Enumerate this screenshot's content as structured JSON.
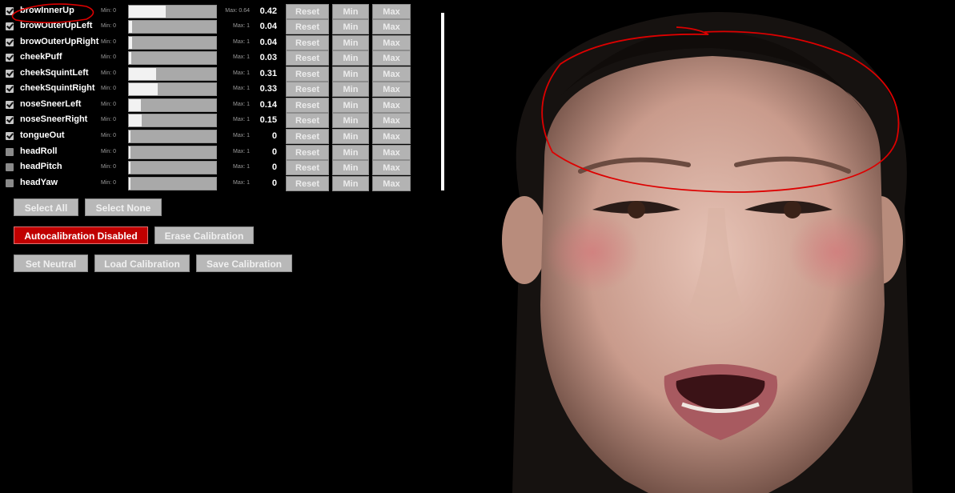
{
  "blendshapes": [
    {
      "name": "browInnerUp",
      "checked": true,
      "min_label": "Min: 0",
      "max_label": "Max: 0.64",
      "value": "0.42",
      "fill": 0.42
    },
    {
      "name": "browOuterUpLeft",
      "checked": true,
      "min_label": "Min: 0",
      "max_label": "Max: 1",
      "value": "0.04",
      "fill": 0.04
    },
    {
      "name": "browOuterUpRight",
      "checked": true,
      "min_label": "Min: 0",
      "max_label": "Max: 1",
      "value": "0.04",
      "fill": 0.04
    },
    {
      "name": "cheekPuff",
      "checked": true,
      "min_label": "Min: 0",
      "max_label": "Max: 1",
      "value": "0.03",
      "fill": 0.03
    },
    {
      "name": "cheekSquintLeft",
      "checked": true,
      "min_label": "Min: 0",
      "max_label": "Max: 1",
      "value": "0.31",
      "fill": 0.31
    },
    {
      "name": "cheekSquintRight",
      "checked": true,
      "min_label": "Min: 0",
      "max_label": "Max: 1",
      "value": "0.33",
      "fill": 0.33
    },
    {
      "name": "noseSneerLeft",
      "checked": true,
      "min_label": "Min: 0",
      "max_label": "Max: 1",
      "value": "0.14",
      "fill": 0.14
    },
    {
      "name": "noseSneerRight",
      "checked": true,
      "min_label": "Min: 0",
      "max_label": "Max: 1",
      "value": "0.15",
      "fill": 0.15
    },
    {
      "name": "tongueOut",
      "checked": true,
      "min_label": "Min: 0",
      "max_label": "Max: 1",
      "value": "0",
      "fill": 0.0
    },
    {
      "name": "headRoll",
      "checked": false,
      "min_label": "Min: 0",
      "max_label": "Max: 1",
      "value": "0",
      "fill": 0.0
    },
    {
      "name": "headPitch",
      "checked": false,
      "min_label": "Min: 0",
      "max_label": "Max: 1",
      "value": "0",
      "fill": 0.0
    },
    {
      "name": "headYaw",
      "checked": false,
      "min_label": "Min: 0",
      "max_label": "Max: 1",
      "value": "0",
      "fill": 0.0
    }
  ],
  "row_buttons": {
    "reset": "Reset",
    "min": "Min",
    "max": "Max"
  },
  "selection": {
    "select_all": "Select All",
    "select_none": "Select None"
  },
  "calibration": {
    "autocalibration": "Autocalibration Disabled",
    "erase": "Erase Calibration",
    "set_neutral": "Set Neutral",
    "load": "Load Calibration",
    "save": "Save Calibration"
  },
  "colors": {
    "autocalibration_bg": "#c00000",
    "annotation": "#dd0000",
    "button_bg": "#b3b3b3"
  }
}
